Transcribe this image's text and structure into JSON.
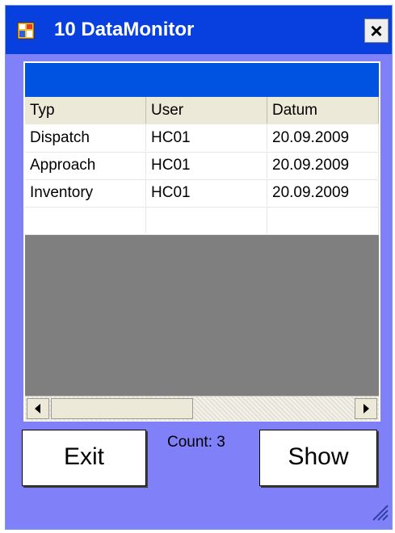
{
  "window": {
    "title": "10 DataMonitor",
    "close_symbol": "×",
    "icon": "app-window-icon"
  },
  "grid": {
    "caption": "",
    "columns": [
      "Typ",
      "User",
      "Datum"
    ],
    "rows": [
      [
        "Dispatch",
        "HC01",
        "20.09.2009"
      ],
      [
        "Approach",
        "HC01",
        "20.09.2009"
      ],
      [
        "Inventory",
        "HC01",
        "20.09.2009"
      ],
      [
        "",
        "",
        ""
      ]
    ]
  },
  "footer": {
    "exit_label": "Exit",
    "count_text": "Count: 3",
    "show_label": "Show"
  },
  "colors": {
    "titlebar": "#0840e0",
    "client_bg": "#8080f8",
    "grid_caption": "#0052e0",
    "grid_empty": "#7f7f7f"
  }
}
